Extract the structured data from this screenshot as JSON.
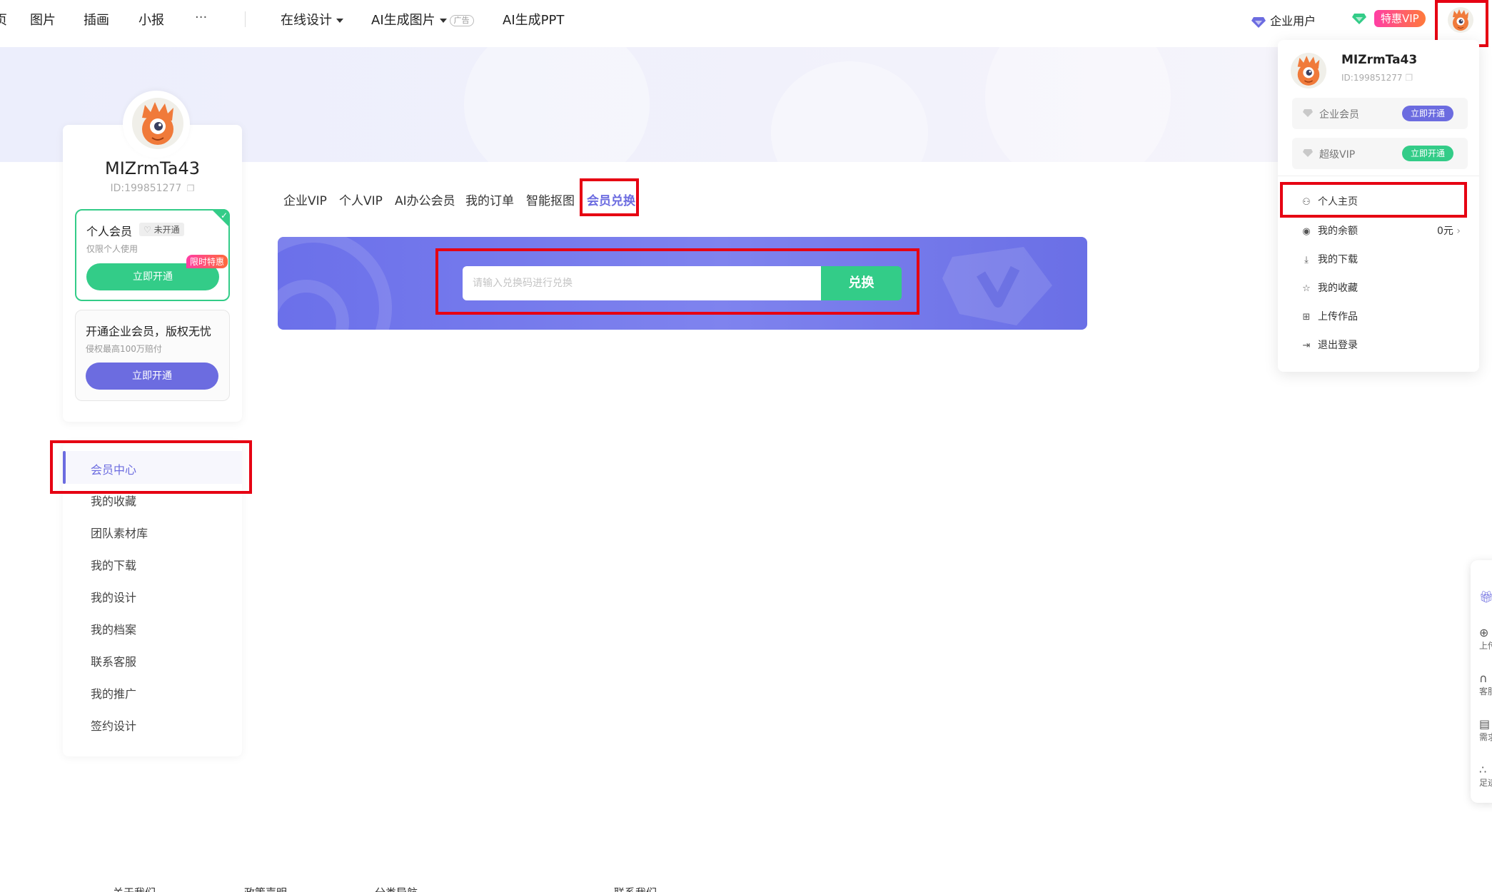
{
  "nav": {
    "home_fragment": "页",
    "items": [
      "图片",
      "插画",
      "小报",
      "···"
    ],
    "online_design": "在线设计",
    "ai_image": "AI生成图片",
    "ad_tag": "广告",
    "ai_ppt": "AI生成PPT",
    "enterprise_user": "企业用户",
    "vip_pill": "特惠VIP"
  },
  "profile": {
    "username": "MIZrmTa43",
    "user_id": "ID:199851277",
    "personal_member": {
      "title": "个人会员",
      "badge": "未开通",
      "subtitle": "仅限个人使用",
      "button": "立即开通",
      "hot_tag": "限时特惠"
    },
    "enterprise_member": {
      "title": "开通企业会员，版权无忧",
      "subtitle": "侵权最高100万赔付",
      "button": "立即开通"
    }
  },
  "side_menu": {
    "items": [
      "会员中心",
      "我的收藏",
      "团队素材库",
      "我的下载",
      "我的设计",
      "我的档案",
      "联系客服",
      "我的推广",
      "签约设计"
    ],
    "active_index": 0
  },
  "tabs": {
    "items": [
      "企业VIP",
      "个人VIP",
      "AI办公会员",
      "我的订单",
      "智能抠图",
      "会员兑换"
    ],
    "active_index": 5
  },
  "redeem": {
    "placeholder": "请输入兑换码进行兑换",
    "button": "兑换"
  },
  "dropdown": {
    "username": "MIZrmTa43",
    "user_id": "ID:199851277",
    "enterprise_member": {
      "label": "企业会员",
      "button": "立即开通"
    },
    "super_vip": {
      "label": "超级VIP",
      "button": "立即开通"
    },
    "items": [
      "个人主页",
      "我的余额",
      "我的下载",
      "我的收藏",
      "上传作品",
      "退出登录"
    ],
    "balance": "0元"
  },
  "float_bar": {
    "items": [
      "上传",
      "客服",
      "需求",
      "足迹"
    ]
  },
  "footer": {
    "links": [
      "关于我们",
      "政策声明",
      "分类导航",
      "联系我们"
    ]
  },
  "colors": {
    "accent": "#6c6ce0",
    "green": "#33cc88",
    "highlight": "#e60012"
  }
}
